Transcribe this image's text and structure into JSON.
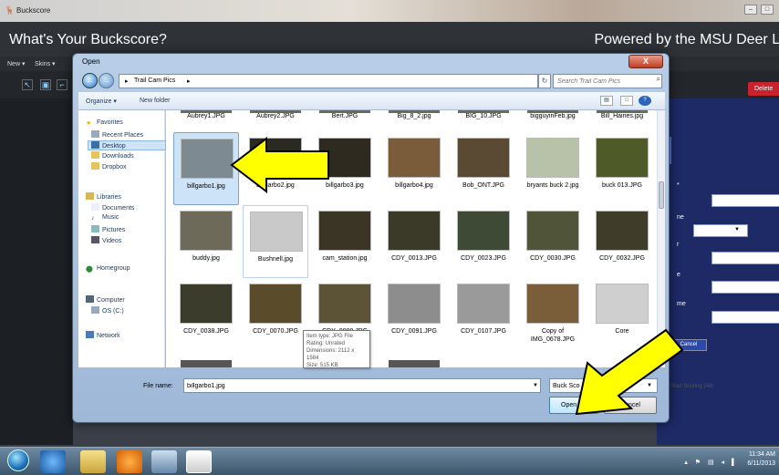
{
  "app": {
    "window_title": "Buckscore",
    "header_left": "What's Your Buckscore?",
    "header_right": "Powered by the MSU Deer La",
    "menu": [
      "New ▾",
      "Skins ▾"
    ],
    "delete_label": "Delete",
    "right_panel": {
      "cancel_label": "Cancel",
      "start_label": "Start Scoring (All)",
      "partial_labels": [
        "*",
        "ne",
        "r",
        "e",
        "me"
      ]
    }
  },
  "dialog": {
    "title": "Open",
    "close_label": "X",
    "breadcrumb": [
      "▸",
      "Trail Cam Pics",
      "▸"
    ],
    "search_placeholder": "Search Trail Cam Pics",
    "toolbar": {
      "organize": "Organize ▾",
      "new_folder": "New folder"
    },
    "nav": {
      "favorites": "Favorites",
      "recent": "Recent Places",
      "desktop": "Desktop",
      "downloads": "Downloads",
      "dropbox": "Dropbox",
      "libraries": "Libraries",
      "documents": "Documents",
      "music": "Music",
      "pictures": "Pictures",
      "videos": "Videos",
      "homegroup": "Homegroup",
      "computer": "Computer",
      "os": "OS (C:)",
      "network": "Network"
    },
    "top_row": [
      "Aubrey1.JPG",
      "Aubrey2.JPG",
      "Bert.JPG",
      "Big_8_2.jpg",
      "BIG_10.JPG",
      "bigguyinFeb.jpg",
      "Bill_Haines.jpg"
    ],
    "row1": [
      {
        "name": "billgarbo1.jpg",
        "color": "#7d8a92"
      },
      {
        "name": "billgarbo2.jpg",
        "color": "#2b2a22"
      },
      {
        "name": "billgarbo3.jpg",
        "color": "#2e2a20"
      },
      {
        "name": "billgarbo4.jpg",
        "color": "#7a5c3a"
      },
      {
        "name": "Bob_ONT.JPG",
        "color": "#5b4a33"
      },
      {
        "name": "bryants buck 2.jpg",
        "color": "#b8c2a8"
      },
      {
        "name": "buck 013.JPG",
        "color": "#4e5a28"
      }
    ],
    "row2": [
      {
        "name": "buddy.jpg",
        "color": "#6d6a5a"
      },
      {
        "name": "Bushnell.jpg",
        "color": "#c9c9c9"
      },
      {
        "name": "cam_station.jpg",
        "color": "#3a3524"
      },
      {
        "name": "CDY_0013.JPG",
        "color": "#3b3a28"
      },
      {
        "name": "CDY_0023.JPG",
        "color": "#3e4a35"
      },
      {
        "name": "CDY_0030.JPG",
        "color": "#505438"
      },
      {
        "name": "CDY_0032.JPG",
        "color": "#403c2a"
      }
    ],
    "row3": [
      {
        "name": "CDY_0038.JPG",
        "color": "#3c3c2c"
      },
      {
        "name": "CDY_0070.JPG",
        "color": "#5a4c2a"
      },
      {
        "name": "CDY_0089.JPG",
        "color": "#5c5236"
      },
      {
        "name": "CDY_0091.JPG",
        "color": "#8d8d8d"
      },
      {
        "name": "CDY_0107.JPG",
        "color": "#9a9a9a"
      },
      {
        "name": "Copy of IMG_0678.JPG",
        "color": "#7a5e3a"
      },
      {
        "name": "Core",
        "color": "#cfcfcf"
      }
    ],
    "tooltip": [
      "Item type: JPG File",
      "Rating: Unrated",
      "Dimensions: 2112 x 1584",
      "Size: 515 KB"
    ],
    "file_name_label": "File name:",
    "file_name_value": "billgarbo1.jpg",
    "filter_value": "Buck Sco",
    "open_label": "Open",
    "cancel_label": "Cancel"
  },
  "taskbar": {
    "clock_time": "11:34 AM",
    "clock_date": "6/11/2013",
    "tray": "▴ ⚑ ▤ ◂ ▌"
  },
  "colors": {
    "arrow": "#ffff00",
    "selection": "#cde3f8",
    "right_panel": "#1d2a66"
  }
}
